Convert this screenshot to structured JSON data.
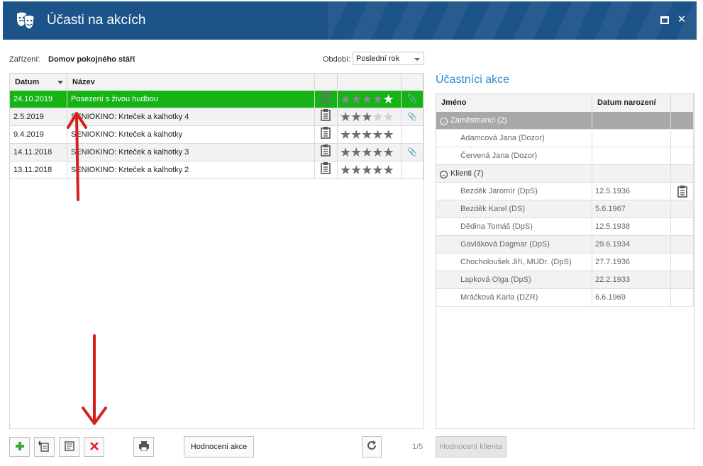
{
  "window": {
    "title": "Účasti na akcích",
    "app_icon": "theater-masks-icon",
    "maximize_icon": "maximize-icon",
    "close_icon": "close-icon",
    "title_bar_color": "#1c5389"
  },
  "filters": {
    "facility_label": "Zařízení:",
    "facility_value": "Domov pokojného stáří",
    "period_label": "Období:",
    "period_value": "Poslední rok"
  },
  "events": {
    "columns": [
      "Datum",
      "Název",
      "",
      "",
      ""
    ],
    "rows": [
      {
        "date": "24.10.2019",
        "name": "Posezení s živou hudbou",
        "rating": 5,
        "attachment": true,
        "selected": true
      },
      {
        "date": "2.5.2019",
        "name": "SENIOKINO: Krteček a kalhotky 4",
        "rating": 3,
        "attachment": true
      },
      {
        "date": "9.4.2019",
        "name": "SENIOKINO: Krteček a kalhotky",
        "rating": 5,
        "attachment": false
      },
      {
        "date": "14.11.2018",
        "name": "SENIOKINO: Krteček a kalhotky 3",
        "rating": 5,
        "attachment": true
      },
      {
        "date": "13.11.2018",
        "name": "SENIOKINO: Krteček a kalhotky 2",
        "rating": 5,
        "attachment": false
      }
    ],
    "selected_color": "#16b316"
  },
  "participants": {
    "title": "Účastníci akce",
    "columns": [
      "Jméno",
      "Datum narození",
      ""
    ],
    "groups": [
      {
        "label": "Zaměstnanci (2)",
        "rows": [
          {
            "name": "Adamcová Jana (Dozor)",
            "birth": ""
          },
          {
            "name": "Červená Jana (Dozor)",
            "birth": ""
          }
        ]
      },
      {
        "label": "Klienti (7)",
        "rows": [
          {
            "name": "Bezděk Jaromír (DpS)",
            "birth": "12.5.1936",
            "note": true
          },
          {
            "name": "Bezděk Karel (DS)",
            "birth": "5.6.1967"
          },
          {
            "name": "Dědina Tomáš (DpS)",
            "birth": "12.5.1938"
          },
          {
            "name": "Gavláková Dagmar (DpS)",
            "birth": "29.6.1934"
          },
          {
            "name": "Chocholoušek Jiří, MUDr. (DpS)",
            "birth": "27.7.1936"
          },
          {
            "name": "Lapková Olga (DpS)",
            "birth": "22.2.1933"
          },
          {
            "name": "Mráčková Karla (DZR)",
            "birth": "6.6.1969"
          }
        ]
      }
    ],
    "accent_color": "#2a8fd4"
  },
  "toolbar": {
    "add_icon": "plus-icon",
    "copy_icon": "copy-add-icon",
    "edit_icon": "edit-note-icon",
    "delete_icon": "delete-x-icon",
    "print_icon": "printer-icon",
    "rate_event_label": "Hodnocení akce",
    "refresh_icon": "refresh-icon",
    "pager": "1/5",
    "rate_client_label": "Hodnocení klienta"
  }
}
